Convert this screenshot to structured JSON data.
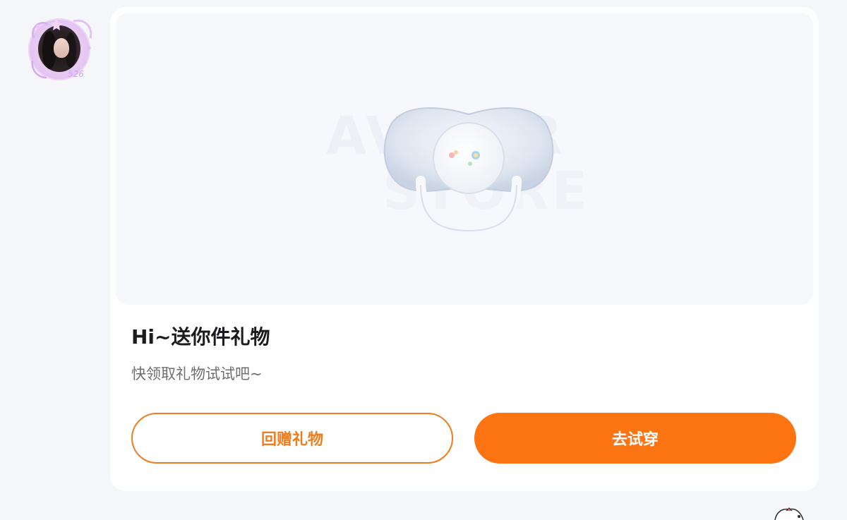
{
  "avatar": {
    "tag": "526"
  },
  "card": {
    "preview": {
      "watermark_line1": "AVATAR",
      "watermark_line2": "STORE",
      "item_icon": "pacifier-icon"
    },
    "title": "Hi~送你件礼物",
    "subtitle": "快领取礼物试试吧~",
    "buttons": {
      "return_gift": "回赠礼物",
      "try_on": "去试穿"
    }
  },
  "colors": {
    "accent": "#fd7412",
    "outline": "#ef7d1f",
    "background": "#f5f6fa",
    "card": "#ffffff",
    "preview_bg": "#f7f8fc"
  }
}
